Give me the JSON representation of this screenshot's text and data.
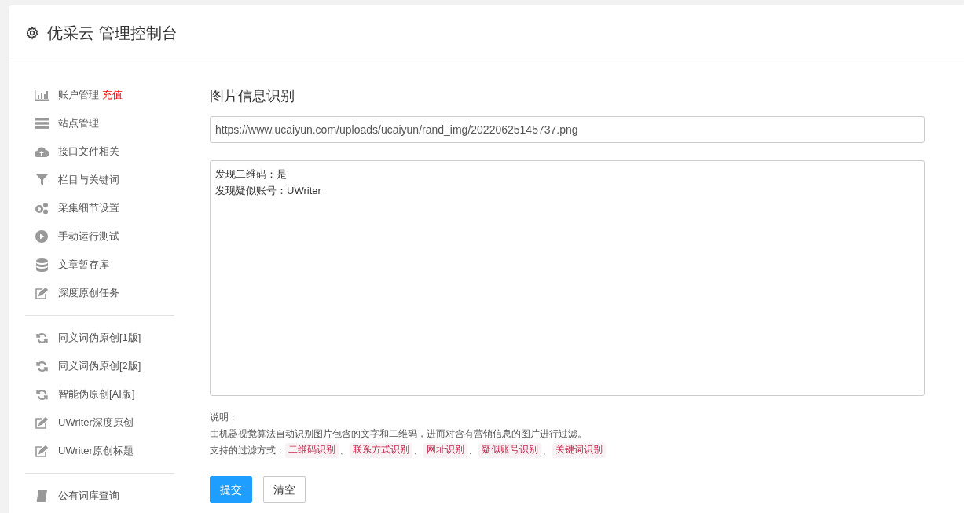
{
  "header": {
    "title": "优采云 管理控制台"
  },
  "sidebar": {
    "groups": [
      {
        "items": [
          {
            "label": "账户管理",
            "badge": "充值"
          },
          {
            "label": "站点管理"
          },
          {
            "label": "接口文件相关"
          },
          {
            "label": "栏目与关键词"
          },
          {
            "label": "采集细节设置"
          },
          {
            "label": "手动运行测试"
          },
          {
            "label": "文章暂存库"
          },
          {
            "label": "深度原创任务"
          }
        ]
      },
      {
        "items": [
          {
            "label": "同义词伪原创[1版]"
          },
          {
            "label": "同义词伪原创[2版]"
          },
          {
            "label": "智能伪原创[AI版]"
          },
          {
            "label": "UWriter深度原创"
          },
          {
            "label": "UWriter原创标题"
          }
        ]
      },
      {
        "items": [
          {
            "label": "公有词库查询"
          }
        ]
      }
    ]
  },
  "main": {
    "title": "图片信息识别",
    "url_field": {
      "value": "https://www.ucaiyun.com/uploads/ucaiyun/rand_img/20220625145737.png"
    },
    "result_box": {
      "lines": [
        "发现二维码：是",
        "发现疑似账号：UWriter"
      ]
    },
    "note_label": "说明：",
    "note_text": "由机器视觉算法自动识别图片包含的文字和二维码，进而对含有营销信息的图片进行过滤。",
    "filters_label": "支持的过滤方式：",
    "filters": [
      "二维码识别",
      "联系方式识别",
      "网址识别",
      "疑似账号识别",
      "关键词识别"
    ],
    "separator": "、",
    "buttons": [
      {
        "label": "提交",
        "kind": "primary"
      },
      {
        "label": "清空",
        "kind": "default"
      }
    ]
  }
}
